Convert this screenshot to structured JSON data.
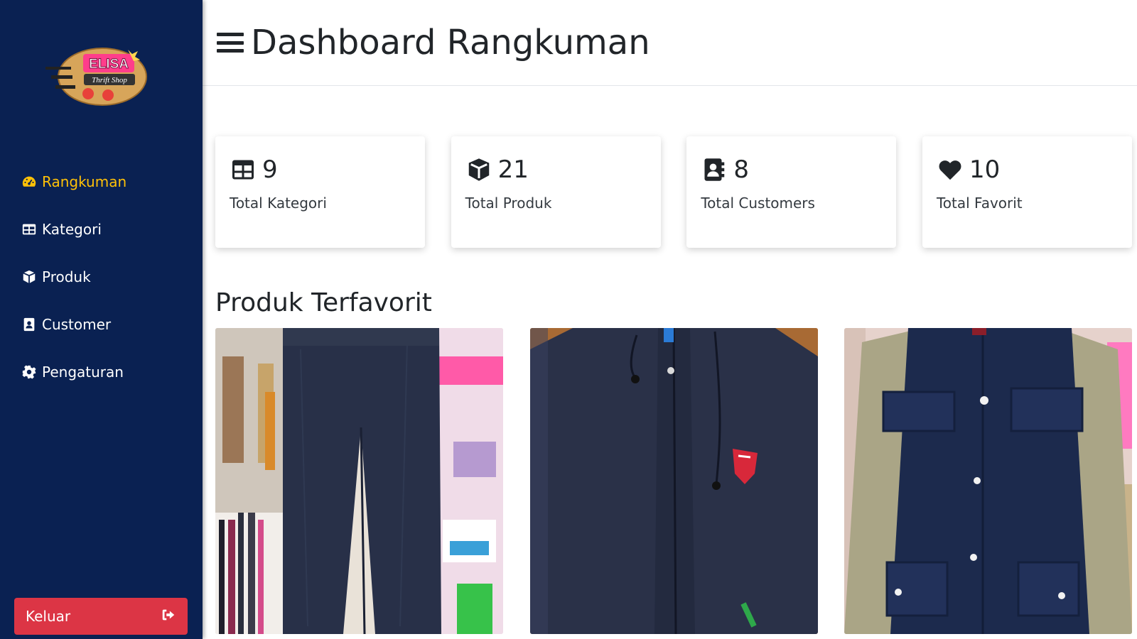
{
  "brand": {
    "logo_text": "ELISA",
    "logo_subtext": "Thrift Shop"
  },
  "sidebar": {
    "items": [
      {
        "label": "Rangkuman",
        "icon": "dashboard-gauge-icon",
        "active": true
      },
      {
        "label": "Kategori",
        "icon": "table-grid-icon",
        "active": false
      },
      {
        "label": "Produk",
        "icon": "box-icon",
        "active": false
      },
      {
        "label": "Customer",
        "icon": "contact-book-icon",
        "active": false
      },
      {
        "label": "Pengaturan",
        "icon": "gear-icon",
        "active": false
      }
    ],
    "logout_label": "Keluar",
    "logout_icon": "sign-out-icon"
  },
  "header": {
    "title": "Dashboard Rangkuman",
    "menu_icon": "hamburger-icon"
  },
  "stats": [
    {
      "value": "9",
      "label": "Total Kategori",
      "icon": "table-grid-icon"
    },
    {
      "value": "21",
      "label": "Total Produk",
      "icon": "box-icon"
    },
    {
      "value": "8",
      "label": "Total Customers",
      "icon": "contact-book-icon"
    },
    {
      "value": "10",
      "label": "Total Favorit",
      "icon": "heart-icon"
    }
  ],
  "favorites": {
    "title": "Produk Terfavorit",
    "products": [
      {
        "name": "pants",
        "photo": "navy trousers hanging"
      },
      {
        "name": "jacket",
        "photo": "navy zip jacket with badge"
      },
      {
        "name": "jacket",
        "photo": "navy and khaki button jacket"
      }
    ]
  },
  "colors": {
    "sidebar_bg": "#0a2152",
    "active_nav": "#ffc107",
    "logout_bg": "#dc3545"
  }
}
